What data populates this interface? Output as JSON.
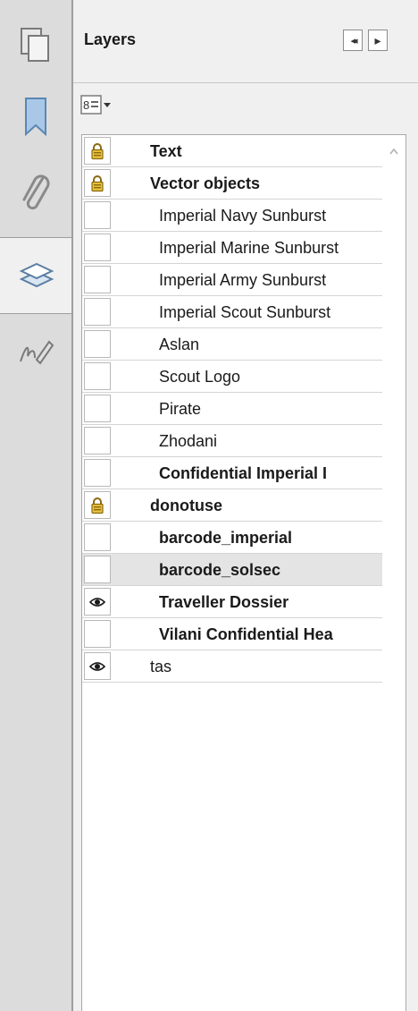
{
  "panel": {
    "title": "Layers",
    "nav_back_glyph": "◂◂",
    "nav_forward_glyph": "▸"
  },
  "tabs": [
    {
      "name": "pages-tab",
      "icon": "pages-icon",
      "active": false
    },
    {
      "name": "bookmarks-tab",
      "icon": "bookmark-icon",
      "active": false
    },
    {
      "name": "attachments-tab",
      "icon": "paperclip-icon",
      "active": false
    },
    {
      "name": "layers-tab",
      "icon": "layers-icon",
      "active": true
    },
    {
      "name": "signatures-tab",
      "icon": "signature-icon",
      "active": false
    }
  ],
  "options": {
    "icon": "options-list-icon",
    "arrow": "chevron-down-icon"
  },
  "layers": [
    {
      "label": "Text",
      "bold": true,
      "indent": 0,
      "state": "locked",
      "selected": false
    },
    {
      "label": "Vector objects",
      "bold": true,
      "indent": 0,
      "state": "locked",
      "selected": false
    },
    {
      "label": "Imperial Navy Sunburst",
      "bold": false,
      "indent": 1,
      "state": "hidden",
      "selected": false
    },
    {
      "label": "Imperial Marine Sunburst",
      "bold": false,
      "indent": 1,
      "state": "hidden",
      "selected": false
    },
    {
      "label": "Imperial Army Sunburst",
      "bold": false,
      "indent": 1,
      "state": "hidden",
      "selected": false
    },
    {
      "label": "Imperial Scout Sunburst",
      "bold": false,
      "indent": 1,
      "state": "hidden",
      "selected": false
    },
    {
      "label": "Aslan",
      "bold": false,
      "indent": 1,
      "state": "hidden",
      "selected": false
    },
    {
      "label": "Scout Logo",
      "bold": false,
      "indent": 1,
      "state": "hidden",
      "selected": false
    },
    {
      "label": "Pirate",
      "bold": false,
      "indent": 1,
      "state": "hidden",
      "selected": false
    },
    {
      "label": "Zhodani",
      "bold": false,
      "indent": 1,
      "state": "hidden",
      "selected": false
    },
    {
      "label": "Confidential Imperial I",
      "bold": true,
      "indent": 1,
      "state": "hidden",
      "selected": false
    },
    {
      "label": "donotuse",
      "bold": true,
      "indent": 0,
      "state": "locked",
      "selected": false
    },
    {
      "label": "barcode_imperial",
      "bold": true,
      "indent": 1,
      "state": "hidden",
      "selected": false
    },
    {
      "label": "barcode_solsec",
      "bold": true,
      "indent": 1,
      "state": "hidden",
      "selected": true
    },
    {
      "label": "Traveller Dossier",
      "bold": true,
      "indent": 1,
      "state": "visible",
      "selected": false
    },
    {
      "label": "Vilani Confidential Hea",
      "bold": true,
      "indent": 1,
      "state": "hidden",
      "selected": false
    },
    {
      "label": "tas",
      "bold": false,
      "indent": 0,
      "state": "visible",
      "selected": false
    }
  ]
}
